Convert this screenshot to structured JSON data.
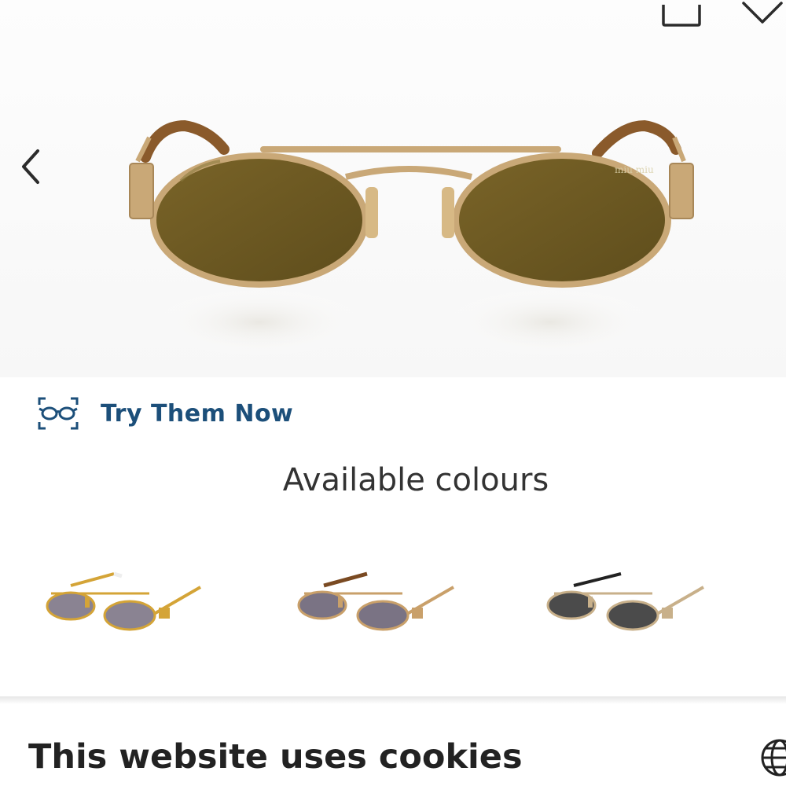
{
  "header": {
    "share_icon": "share-icon",
    "wishlist_icon": "heart-icon",
    "prev_icon": "chevron-left-icon"
  },
  "product": {
    "brand_engraving": "miu miu",
    "lens_color": "#6e5a23",
    "frame_color": "#c9a877"
  },
  "try_on": {
    "icon": "glasses-icon",
    "label": "Try Them Now",
    "color": "#1c4f7a"
  },
  "colours": {
    "title": "Available colours",
    "swatches": [
      {
        "frame": "#d4a437",
        "lens": "#8a8392",
        "temple_tip": "#eeeeee"
      },
      {
        "frame": "#c9a06a",
        "lens": "#7a7384",
        "temple_tip": "#7a4a22"
      },
      {
        "frame": "#c8b08a",
        "lens": "#4b4b4b",
        "temple_tip": "#222222"
      }
    ]
  },
  "cookie_banner": {
    "title": "This website uses cookies",
    "language_icon": "globe-icon"
  }
}
